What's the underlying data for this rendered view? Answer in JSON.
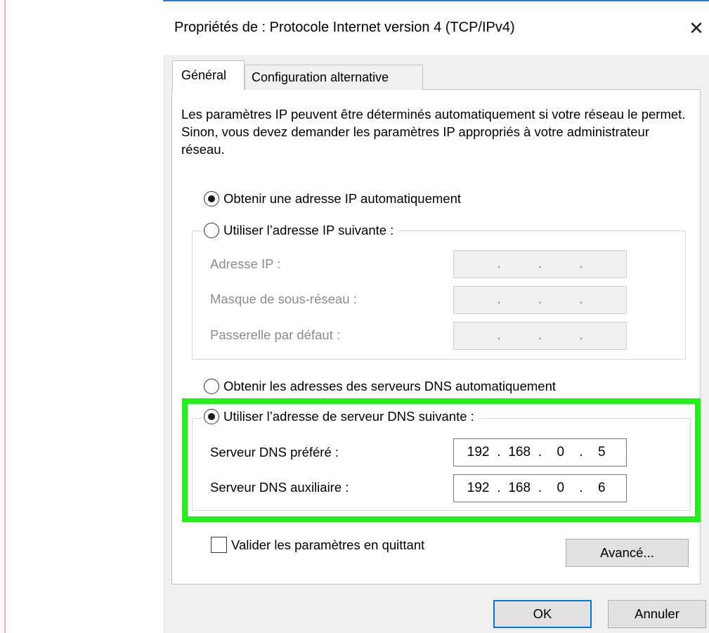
{
  "window": {
    "title": "Propriétés de : Protocole Internet version 4 (TCP/IPv4)",
    "close": "✕"
  },
  "tabs": [
    {
      "label": "Général",
      "active": true
    },
    {
      "label": "Configuration alternative",
      "active": false
    }
  ],
  "description": "Les paramètres IP peuvent être déterminés automatiquement si votre réseau le permet. Sinon, vous devez demander les paramètres IP appropriés à votre administrateur réseau.",
  "ip": {
    "auto_label": "Obtenir une adresse IP automatiquement",
    "auto_selected": true,
    "manual_label": "Utiliser l’adresse IP suivante :",
    "manual_selected": false,
    "fields": [
      {
        "label": "Adresse IP :",
        "value": [
          ".",
          ".",
          "."
        ]
      },
      {
        "label": "Masque de sous-réseau :",
        "value": [
          ".",
          ".",
          "."
        ]
      },
      {
        "label": "Passerelle par défaut :",
        "value": [
          ".",
          ".",
          "."
        ]
      }
    ]
  },
  "dns": {
    "auto_label": "Obtenir les adresses des serveurs DNS automatiquement",
    "auto_selected": false,
    "manual_label": "Utiliser l’adresse de serveur DNS suivante :",
    "manual_selected": true,
    "preferred": {
      "label": "Serveur DNS préféré :",
      "octets": [
        "192",
        "168",
        "0",
        "5"
      ]
    },
    "alternate": {
      "label": "Serveur DNS auxiliaire :",
      "octets": [
        "192",
        "168",
        "0",
        "6"
      ]
    }
  },
  "validate_label": "Valider les paramètres en quittant",
  "buttons": {
    "advanced": "Avancé...",
    "ok": "OK",
    "cancel": "Annuler"
  },
  "colors": {
    "highlight": "#22f018",
    "ok_border": "#0078d7",
    "title_accent": "#2c7fd3"
  }
}
